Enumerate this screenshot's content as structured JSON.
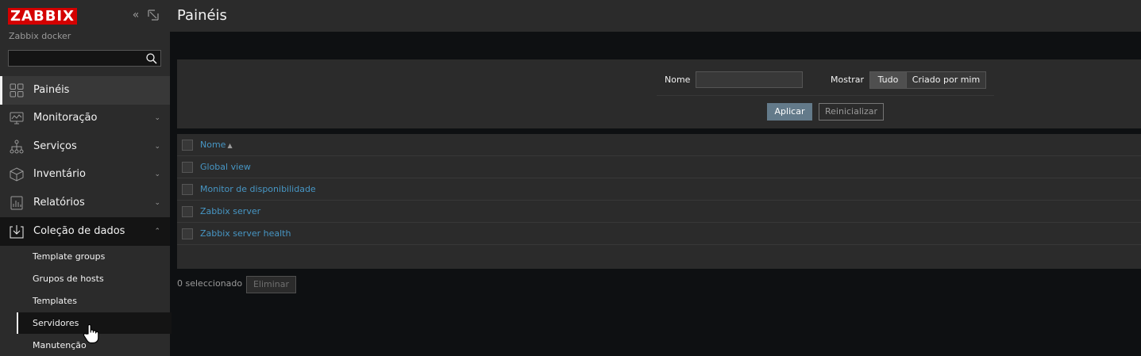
{
  "brand": {
    "logo_text": "ZABBIX",
    "server_name": "Zabbix docker",
    "logo_color": "#d40000"
  },
  "sidebar": {
    "collapse_icon": "double-chevron-left-icon",
    "kiosk_icon": "expand-icon",
    "search": {
      "value": "",
      "placeholder": "",
      "icon": "search-icon"
    },
    "menu": [
      {
        "label": "Painéis",
        "icon": "dashboard-icon",
        "state": "selected"
      },
      {
        "label": "Monitoração",
        "icon": "monitor-icon",
        "arrow": "⌄"
      },
      {
        "label": "Serviços",
        "icon": "services-tree-icon",
        "arrow": "⌄"
      },
      {
        "label": "Inventário",
        "icon": "box-icon",
        "arrow": "⌄"
      },
      {
        "label": "Relatórios",
        "icon": "report-chart-icon",
        "arrow": "⌄"
      },
      {
        "label": "Coleção de dados",
        "icon": "data-collection-icon",
        "arrow": "⌃",
        "state": "open"
      }
    ],
    "submenu": [
      {
        "label": "Template groups"
      },
      {
        "label": "Grupos de hosts"
      },
      {
        "label": "Templates"
      },
      {
        "label": "Servidores",
        "state": "active"
      },
      {
        "label": "Manutenção"
      }
    ],
    "cursor_icon": "hand-pointer-icon"
  },
  "header": {
    "title": "Painéis"
  },
  "filter": {
    "name_label": "Nome",
    "name_value": "",
    "show_label": "Mostrar",
    "show_options": [
      {
        "label": "Tudo",
        "selected": true
      },
      {
        "label": "Criado por mim",
        "selected": false
      }
    ],
    "apply_label": "Aplicar",
    "reset_label": "Reinicializar"
  },
  "table": {
    "header": {
      "name": "Nome",
      "sort_indicator": "▲"
    },
    "rows": [
      {
        "name": "Global view"
      },
      {
        "name": "Monitor de disponibilidade"
      },
      {
        "name": "Zabbix server"
      },
      {
        "name": "Zabbix server health"
      }
    ]
  },
  "footer": {
    "selected_count": "0 seleccionado",
    "delete_label": "Eliminar"
  },
  "colors": {
    "link": "#4796c4",
    "apply_button": "#637a8a",
    "panel": "#2b2b2b",
    "background": "#0e1012"
  }
}
